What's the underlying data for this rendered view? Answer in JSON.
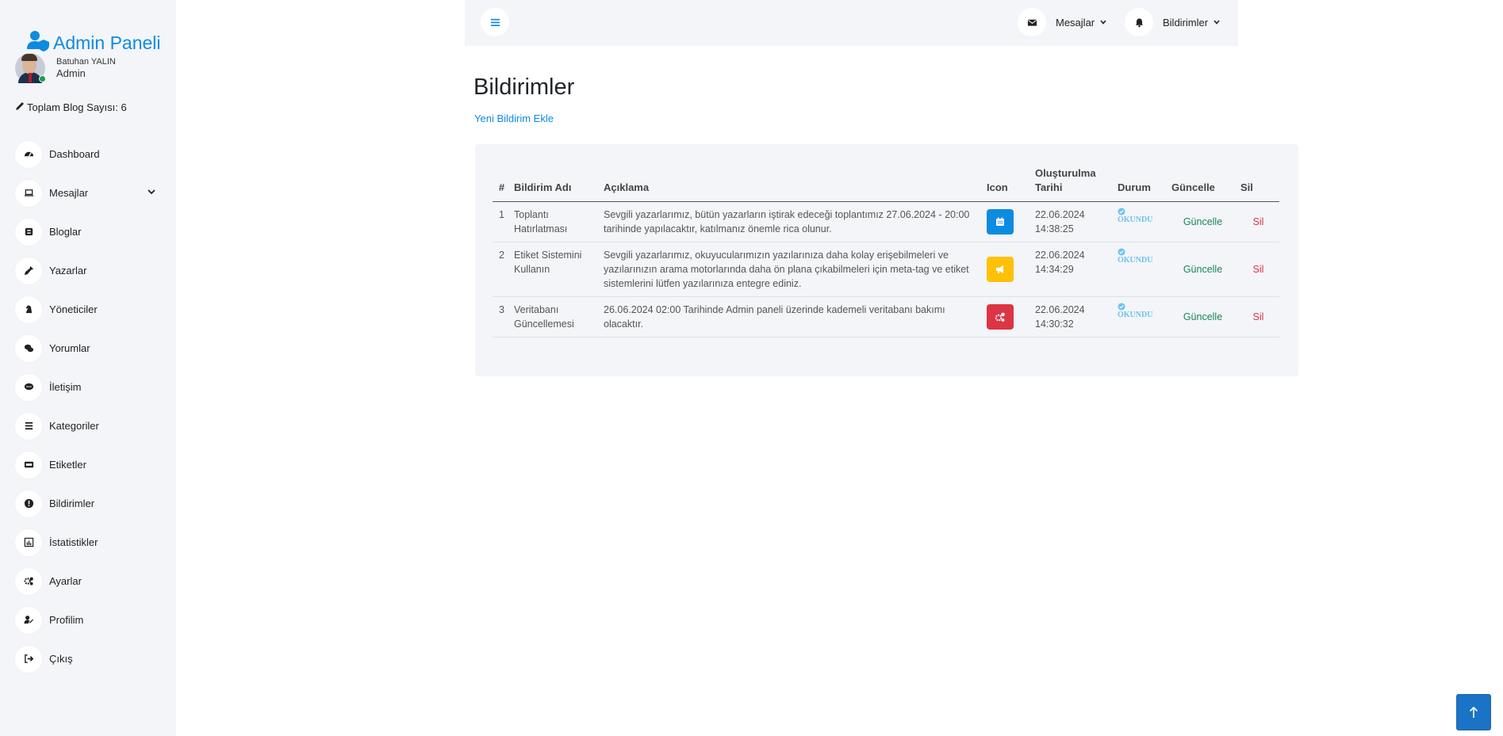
{
  "sidebar": {
    "brand": "Admin Paneli",
    "user_name": "Batuhan YALIN",
    "user_role": "Admin",
    "blog_count": "Toplam Blog Sayısı: 6",
    "items": [
      {
        "label": "Dashboard",
        "icon": "dashboard-icon"
      },
      {
        "label": "Mesajlar",
        "icon": "laptop-icon"
      },
      {
        "label": "Bloglar",
        "icon": "blog-icon"
      },
      {
        "label": "Yazarlar",
        "icon": "pen-nib-icon"
      },
      {
        "label": "Yöneticiler",
        "icon": "chess-knight-icon"
      },
      {
        "label": "Yorumlar",
        "icon": "comments-icon"
      },
      {
        "label": "İletişim",
        "icon": "comment-dots-icon"
      },
      {
        "label": "Kategoriler",
        "icon": "list-icon"
      },
      {
        "label": "Etiketler",
        "icon": "tag-icon"
      },
      {
        "label": "Bildirimler",
        "icon": "exclamation-circle-icon"
      },
      {
        "label": "İstatistikler",
        "icon": "chart-icon"
      },
      {
        "label": "Ayarlar",
        "icon": "cogs-icon"
      },
      {
        "label": "Profilim",
        "icon": "user-edit-icon"
      },
      {
        "label": "Çıkış",
        "icon": "sign-out-icon"
      }
    ]
  },
  "topbar": {
    "messages_label": "Mesajlar",
    "notifications_label": "Bildirimler"
  },
  "main": {
    "title": "Bildirimler",
    "new_link": "Yeni Bildirim Ekle"
  },
  "table": {
    "headers": {
      "num": "#",
      "name": "Bildirim Adı",
      "desc": "Açıklama",
      "icon": "Icon",
      "date": "Oluşturulma Tarihi",
      "status": "Durum",
      "update": "Güncelle",
      "delete": "Sil"
    },
    "rows": [
      {
        "num": "1",
        "name": "Toplantı Hatırlatması",
        "desc": "Sevgili yazarlarımız, bütün yazarların iştirak edeceği toplantımız 27.06.2024 - 20:00 tarihinde yapılacaktır, katılmanız önemle rica olunur.",
        "icon": "calendar-icon",
        "icon_color": "#0d8be0",
        "date": "22.06.2024 14:38:25",
        "status": "OKUNDU",
        "update": "Güncelle",
        "delete": "Sil"
      },
      {
        "num": "2",
        "name": "Etiket Sistemini Kullanın",
        "desc": "Sevgili yazarlarımız, okuyucularımızın yazılarınıza daha kolay erişebilmeleri ve yazılarınızın arama motorlarında daha ön plana çıkabilmeleri için meta-tag ve etiket sistemlerini lütfen yazılarınıza entegre ediniz.",
        "icon": "bullhorn-icon",
        "icon_color": "#ffc107",
        "date": "22.06.2024 14:34:29",
        "status": "OKUNDU",
        "update": "Güncelle",
        "delete": "Sil"
      },
      {
        "num": "3",
        "name": "Veritabanı Güncellemesi",
        "desc": "26.06.2024 02:00 Tarihinde Admin paneli üzerinde kademeli veritabanı bakımı olacaktır.",
        "icon": "cogs-icon",
        "icon_color": "#dc3545",
        "date": "22.06.2024 14:30:32",
        "status": "OKUNDU",
        "update": "Güncelle",
        "delete": "Sil"
      }
    ]
  },
  "colors": {
    "accent": "#0d8be0",
    "success": "#198754",
    "danger": "#dc3545",
    "read_status": "#6cc3ef",
    "scroll_button": "#1a73c4"
  }
}
